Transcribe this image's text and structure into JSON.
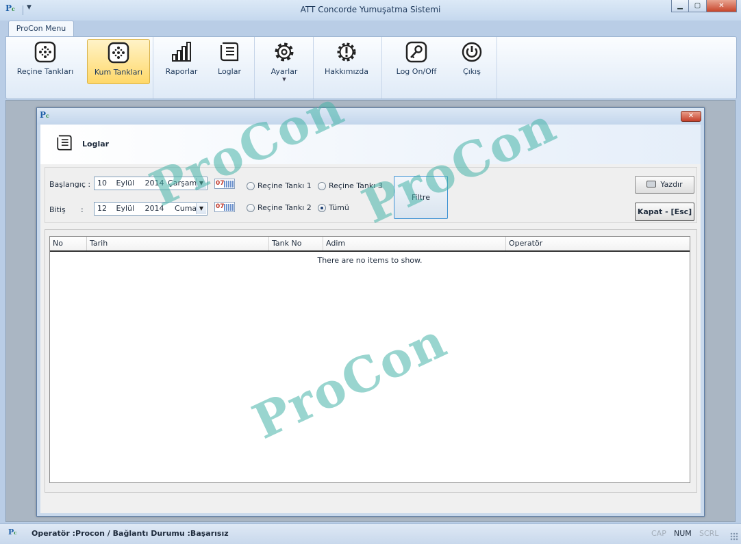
{
  "window": {
    "title": "ATT Concorde Yumuşatma Sistemi"
  },
  "ribbon": {
    "tab": "ProCon Menu",
    "buttons": [
      {
        "label": "Reçine Tankları",
        "icon": "tank-icon"
      },
      {
        "label": "Kum Tankları",
        "icon": "tank-icon",
        "active": true
      },
      {
        "label": "Raporlar",
        "icon": "chart-bars-icon"
      },
      {
        "label": "Loglar",
        "icon": "log-scroll-icon"
      },
      {
        "label": "Ayarlar",
        "icon": "gear-icon",
        "dropdown": true
      },
      {
        "label": "Hakkımızda",
        "icon": "info-badge-icon"
      },
      {
        "label": "Log On/Off",
        "icon": "key-icon"
      },
      {
        "label": "Çıkış",
        "icon": "power-icon"
      }
    ]
  },
  "dialog": {
    "header": "Loglar",
    "start": {
      "label": "Başlangıç :",
      "day": "10",
      "month": "Eylül",
      "year": "2014",
      "weekday": "Çarşamba",
      "cal": "07"
    },
    "end": {
      "label": "Bitiş",
      "colon": ":",
      "day": "12",
      "month": "Eylül",
      "year": "2014",
      "weekday": "Cuma",
      "cal": "07"
    },
    "radios": [
      {
        "label": "Reçine Tankı 1",
        "checked": false
      },
      {
        "label": "Reçine Tankı 3",
        "checked": false
      },
      {
        "label": "Reçine Tankı 2",
        "checked": false
      },
      {
        "label": "Tümü",
        "checked": true
      }
    ],
    "filter_button": "Filtre",
    "print_button": "Yazdır",
    "close_button": "Kapat - [Esc]",
    "columns": [
      "No",
      "Tarih",
      "Tank No",
      "Adim",
      "Operatör"
    ],
    "empty_message": "There are no items to show."
  },
  "watermark": "ProCon",
  "status": {
    "text": "Operatör :Procon / Bağlantı Durumu :Başarısız",
    "indicators": [
      {
        "label": "CAP",
        "active": false
      },
      {
        "label": "NUM",
        "active": true
      },
      {
        "label": "SCRL",
        "active": false
      }
    ]
  },
  "colors": {
    "accent": "#ffd869",
    "watermark": "#46b2a8",
    "close": "#c5402a"
  }
}
